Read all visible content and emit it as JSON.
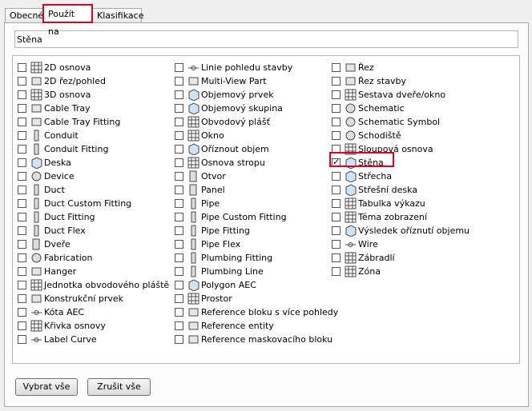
{
  "tabs": [
    {
      "label": "Obecné"
    },
    {
      "label": "Použít na"
    },
    {
      "label": "Klasifikace"
    }
  ],
  "name_field": {
    "value": "Stěna"
  },
  "columns": [
    [
      {
        "label": "2D osnova",
        "icon": "grid-icon",
        "checked": false
      },
      {
        "label": "2D řez/pohled",
        "icon": "section-icon",
        "checked": false
      },
      {
        "label": "3D osnova",
        "icon": "grid3d-icon",
        "checked": false
      },
      {
        "label": "Cable Tray",
        "icon": "cable-tray-icon",
        "checked": false
      },
      {
        "label": "Cable Tray Fitting",
        "icon": "cable-tray-fitting-icon",
        "checked": false
      },
      {
        "label": "Conduit",
        "icon": "conduit-icon",
        "checked": false
      },
      {
        "label": "Conduit Fitting",
        "icon": "conduit-fitting-icon",
        "checked": false
      },
      {
        "label": "Deska",
        "icon": "slab-icon",
        "checked": false
      },
      {
        "label": "Device",
        "icon": "device-icon",
        "checked": false
      },
      {
        "label": "Duct",
        "icon": "duct-icon",
        "checked": false
      },
      {
        "label": "Duct Custom Fitting",
        "icon": "duct-custom-fitting-icon",
        "checked": false
      },
      {
        "label": "Duct Fitting",
        "icon": "duct-fitting-icon",
        "checked": false
      },
      {
        "label": "Duct Flex",
        "icon": "duct-flex-icon",
        "checked": false
      },
      {
        "label": "Dveře",
        "icon": "door-icon",
        "checked": false
      },
      {
        "label": "Fabrication",
        "icon": "fabrication-icon",
        "checked": false
      },
      {
        "label": "Hanger",
        "icon": "hanger-icon",
        "checked": false
      },
      {
        "label": "Jednotka obvodového pláště",
        "icon": "curtain-unit-icon",
        "checked": false
      },
      {
        "label": "Konstrukční prvek",
        "icon": "structural-member-icon",
        "checked": false
      },
      {
        "label": "Kóta AEC",
        "icon": "dimension-icon",
        "checked": false
      },
      {
        "label": "Křivka osnovy",
        "icon": "grid-curve-icon",
        "checked": false
      },
      {
        "label": "Label Curve",
        "icon": "label-curve-icon",
        "checked": false
      }
    ],
    [
      {
        "label": "Linie pohledu stavby",
        "icon": "view-line-icon",
        "checked": false
      },
      {
        "label": "Multi-View Part",
        "icon": "multiview-icon",
        "checked": false
      },
      {
        "label": "Objemový prvek",
        "icon": "mass-element-icon",
        "checked": false
      },
      {
        "label": "Objemový skupina",
        "icon": "mass-group-icon",
        "checked": false
      },
      {
        "label": "Obvodový plášť",
        "icon": "curtain-wall-icon",
        "checked": false
      },
      {
        "label": "Okno",
        "icon": "window-icon",
        "checked": false
      },
      {
        "label": "Oříznout objem",
        "icon": "clip-volume-icon",
        "checked": false
      },
      {
        "label": "Osnova stropu",
        "icon": "ceiling-grid-icon",
        "checked": false
      },
      {
        "label": "Otvor",
        "icon": "opening-icon",
        "checked": false
      },
      {
        "label": "Panel",
        "icon": "panel-icon",
        "checked": false
      },
      {
        "label": "Pipe",
        "icon": "pipe-icon",
        "checked": false
      },
      {
        "label": "Pipe Custom Fitting",
        "icon": "pipe-custom-fitting-icon",
        "checked": false
      },
      {
        "label": "Pipe Fitting",
        "icon": "pipe-fitting-icon",
        "checked": false
      },
      {
        "label": "Pipe Flex",
        "icon": "pipe-flex-icon",
        "checked": false
      },
      {
        "label": "Plumbing Fitting",
        "icon": "plumbing-fitting-icon",
        "checked": false
      },
      {
        "label": "Plumbing Line",
        "icon": "plumbing-line-icon",
        "checked": false
      },
      {
        "label": "Polygon AEC",
        "icon": "polygon-icon",
        "checked": false
      },
      {
        "label": "Prostor",
        "icon": "space-icon",
        "checked": false
      },
      {
        "label": "Reference bloku s více pohledy",
        "icon": "block-ref-icon",
        "checked": false
      },
      {
        "label": "Reference entity",
        "icon": "entity-ref-icon",
        "checked": false
      },
      {
        "label": "Reference maskovacího bloku",
        "icon": "mask-block-icon",
        "checked": false
      }
    ],
    [
      {
        "label": "Řez",
        "icon": "section-cut-icon",
        "checked": false
      },
      {
        "label": "Řez stavby",
        "icon": "building-section-icon",
        "checked": false
      },
      {
        "label": "Sestava dveře/okno",
        "icon": "door-window-assembly-icon",
        "checked": false
      },
      {
        "label": "Schematic",
        "icon": "schematic-icon",
        "checked": false
      },
      {
        "label": "Schematic Symbol",
        "icon": "schematic-symbol-icon",
        "checked": false
      },
      {
        "label": "Schodiště",
        "icon": "stair-icon",
        "checked": false
      },
      {
        "label": "Sloupová osnova",
        "icon": "column-grid-icon",
        "checked": false
      },
      {
        "label": "Stěna",
        "icon": "wall-icon",
        "checked": true
      },
      {
        "label": "Střecha",
        "icon": "roof-icon",
        "checked": false
      },
      {
        "label": "Střešní deska",
        "icon": "roof-slab-icon",
        "checked": false
      },
      {
        "label": "Tabulka výkazu",
        "icon": "schedule-table-icon",
        "checked": false
      },
      {
        "label": "Téma zobrazení",
        "icon": "display-theme-icon",
        "checked": false
      },
      {
        "label": "Výsledek oříznutí objemu",
        "icon": "clip-result-icon",
        "checked": false
      },
      {
        "label": "Wire",
        "icon": "wire-icon",
        "checked": false
      },
      {
        "label": "Zábradlí",
        "icon": "railing-icon",
        "checked": false
      },
      {
        "label": "Zóna",
        "icon": "zone-icon",
        "checked": false
      }
    ]
  ],
  "buttons": {
    "select_all": "Vybrat vše",
    "deselect_all": "Zrušit vše"
  },
  "colors": {
    "highlight": "#e3001b"
  }
}
